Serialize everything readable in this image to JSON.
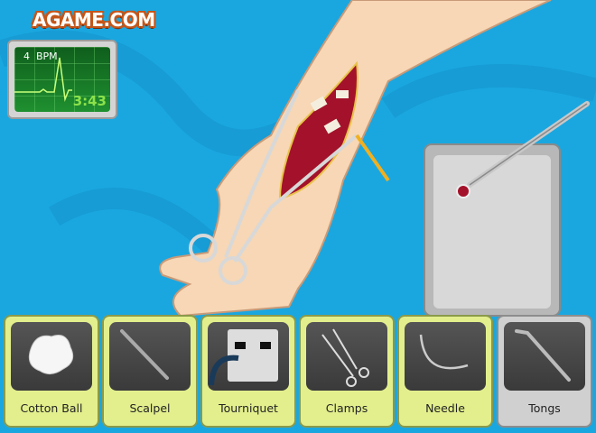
{
  "brand": {
    "logo_text": "AGAME.COM"
  },
  "monitor": {
    "bpm_value": "4",
    "bpm_unit": "BPM",
    "timer": "3:43",
    "screen_color": "#1c8a2c",
    "timer_color": "#8be24a"
  },
  "toolbar": {
    "selected": "Tongs",
    "tools": [
      {
        "label": "Cotton Ball",
        "icon": "cotton-ball-icon"
      },
      {
        "label": "Scalpel",
        "icon": "scalpel-icon"
      },
      {
        "label": "Tourniquet",
        "icon": "tourniquet-icon"
      },
      {
        "label": "Clamps",
        "icon": "clamps-icon"
      },
      {
        "label": "Needle",
        "icon": "needle-icon"
      },
      {
        "label": "Tongs",
        "icon": "tongs-icon"
      }
    ]
  },
  "colors": {
    "background": "#1aa7e0",
    "tool_button": "#e3ef8d",
    "tool_selected": "#d0d0d0",
    "skin": "#f7d7b5",
    "wound": "#a3122a"
  }
}
